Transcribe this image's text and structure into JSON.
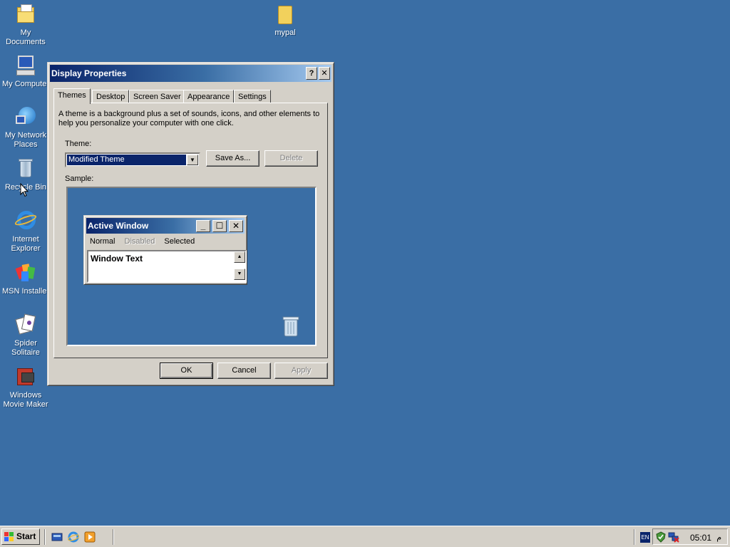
{
  "desktop": {
    "icons": [
      {
        "label": "My Documents",
        "icon": "my-documents-icon"
      },
      {
        "label": "mypal",
        "icon": "folder-icon"
      },
      {
        "label": "My Computer",
        "icon": "my-computer-icon"
      },
      {
        "label": "My Network Places",
        "icon": "network-places-icon"
      },
      {
        "label": "Recycle Bin",
        "icon": "recycle-bin-icon"
      },
      {
        "label": "Internet Explorer",
        "icon": "internet-explorer-icon"
      },
      {
        "label": "MSN Installer",
        "icon": "msn-installer-icon"
      },
      {
        "label": "Spider Solitaire",
        "icon": "spider-solitaire-icon"
      },
      {
        "label": "Windows Movie Maker",
        "icon": "movie-maker-icon"
      }
    ],
    "background_color": "#3a6ea5"
  },
  "window": {
    "title": "Display Properties",
    "help_glyph": "?",
    "close_glyph": "✕",
    "tabs": [
      {
        "label": "Themes",
        "active": true
      },
      {
        "label": "Desktop",
        "active": false
      },
      {
        "label": "Screen Saver",
        "active": false
      },
      {
        "label": "Appearance",
        "active": false
      },
      {
        "label": "Settings",
        "active": false
      }
    ],
    "description": "A theme is a background plus a set of sounds, icons, and other elements to help you personalize your computer with one click.",
    "theme_label": "Theme:",
    "theme_value": "Modified Theme",
    "save_as_label": "Save As...",
    "delete_label": "Delete",
    "sample_label": "Sample:",
    "sample": {
      "title": "Active Window",
      "menu": {
        "normal": "Normal",
        "disabled": "Disabled",
        "selected": "Selected"
      },
      "window_text": "Window Text"
    },
    "ok_label": "OK",
    "cancel_label": "Cancel",
    "apply_label": "Apply"
  },
  "taskbar": {
    "start_label": "Start",
    "language": "EN",
    "clock": "05:01",
    "clock_suffix": "م"
  }
}
